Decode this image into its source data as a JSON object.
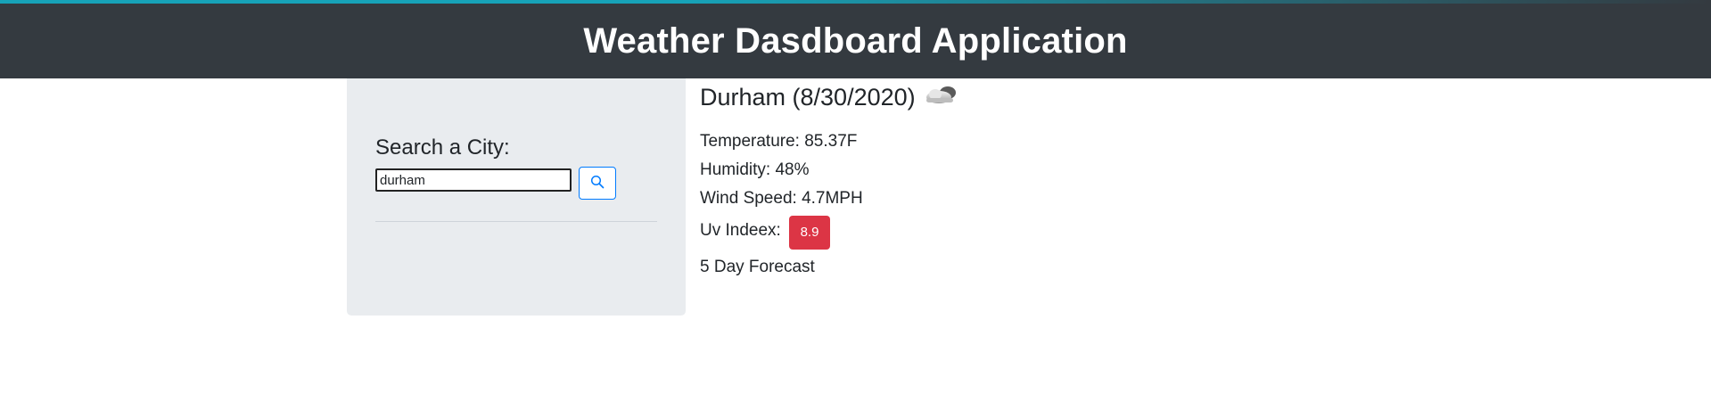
{
  "header": {
    "title": "Weather Dasdboard Application"
  },
  "sidebar": {
    "search_label": "Search a City:",
    "search_value": "durham",
    "search_button_icon": "search-icon"
  },
  "current": {
    "title": "Durham (8/30/2020)",
    "weather_icon": "cloud-icon",
    "temperature": "Temperature: 85.37F",
    "humidity": "Humidity: 48%",
    "wind_speed": "Wind Speed: 4.7MPH",
    "uv_label": "Uv Indeex:",
    "uv_value": "8.9",
    "forecast_heading": "5 Day Forecast"
  },
  "colors": {
    "header_bg": "#343a40",
    "accent": "#17a2b8",
    "sidebar_bg": "#e9ecef",
    "uv_badge": "#dc3545",
    "button_border": "#007bff"
  }
}
